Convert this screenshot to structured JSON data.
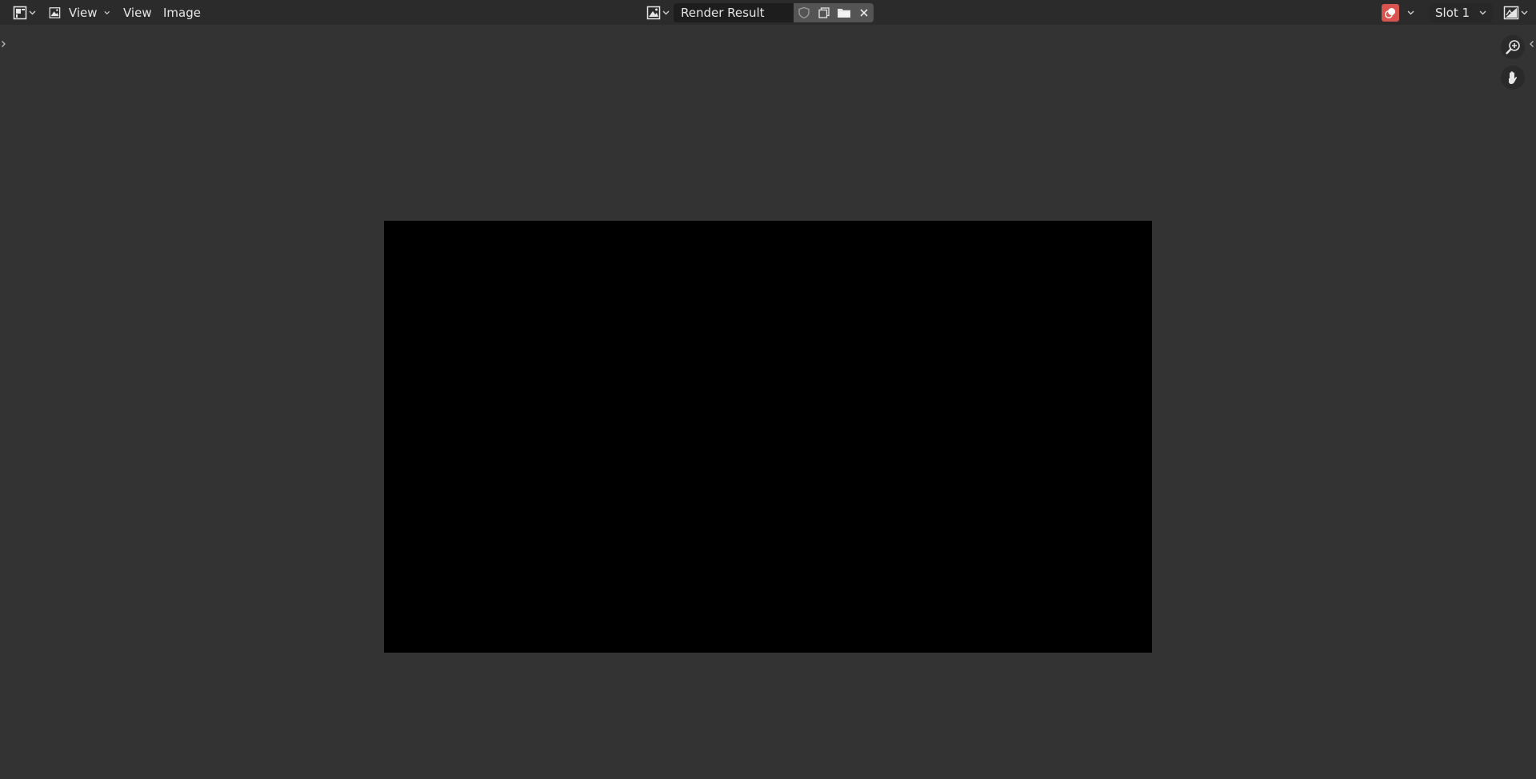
{
  "header": {
    "editor_type_icon": "image-editor-icon",
    "mode_label": "View",
    "menus": [
      "View",
      "Image"
    ],
    "image_name": "Render Result",
    "slot_label": "Slot 1"
  },
  "icons": {
    "fake_user": "shield-icon",
    "new_image": "duplicate-icon",
    "open_image": "folder-icon",
    "unlink": "close-icon",
    "render_slot": "render-result-icon",
    "display_channels": "display-channels-icon",
    "zoom": "zoom-icon",
    "pan": "hand-icon"
  },
  "colors": {
    "header_bg": "#2b2b2b",
    "viewport_bg": "#333333",
    "canvas_bg": "#000000",
    "render_badge": "#d9534f"
  }
}
